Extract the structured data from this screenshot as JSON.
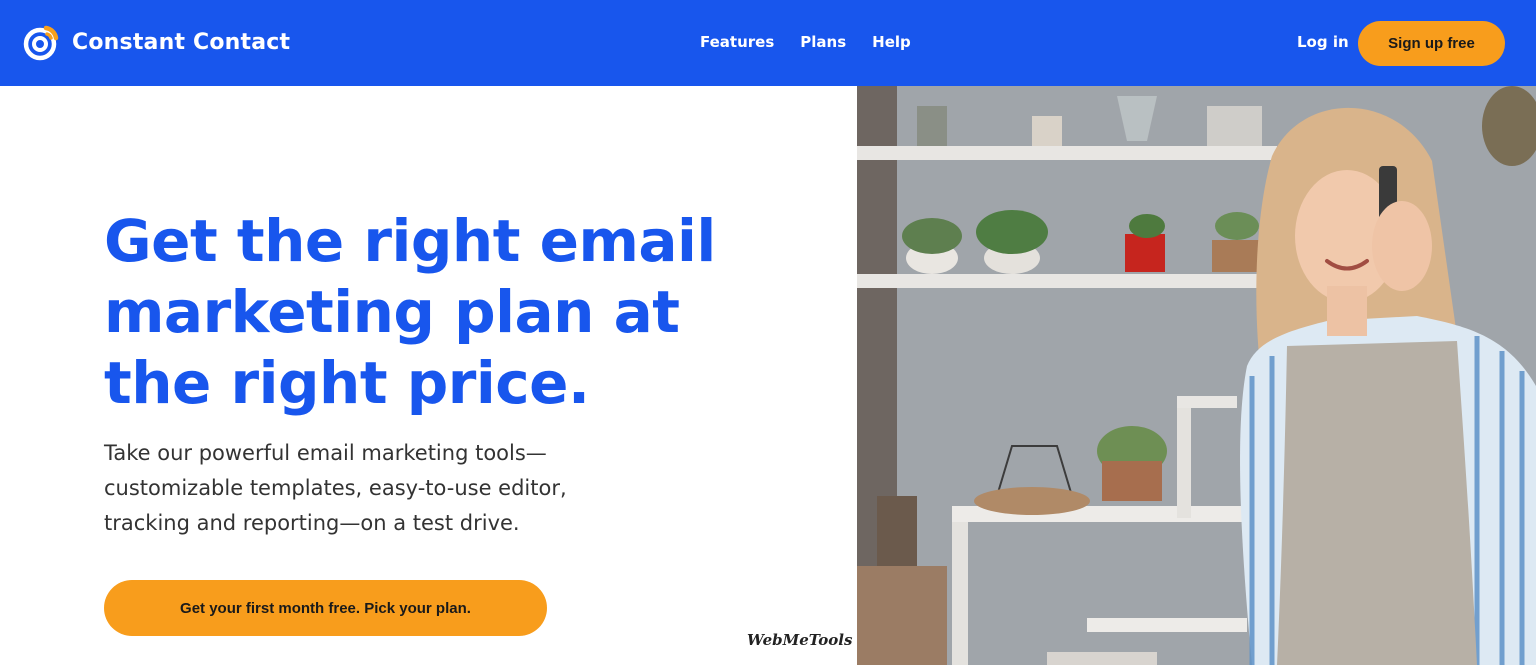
{
  "header": {
    "brand_name": "Constant Contact",
    "nav": [
      "Features",
      "Plans",
      "Help"
    ],
    "login_label": "Log in",
    "signup_label": "Sign up free"
  },
  "hero": {
    "title_lines": [
      "Get the right email",
      "marketing plan at",
      "the right price."
    ],
    "body_lines": [
      "Take our powerful email marketing tools—",
      "customizable templates, easy-to-use editor,",
      "tracking and reporting—on a test drive."
    ],
    "cta_label": "Get your first month free. Pick your plan."
  },
  "watermark": "WebMeTools",
  "colors": {
    "brand_blue": "#1856ED",
    "accent_orange": "#F89D1C",
    "text_dark": "#333333",
    "logo_orange": "#F9A01B"
  },
  "icons": {
    "brand_logo": "constant-contact-logo"
  }
}
